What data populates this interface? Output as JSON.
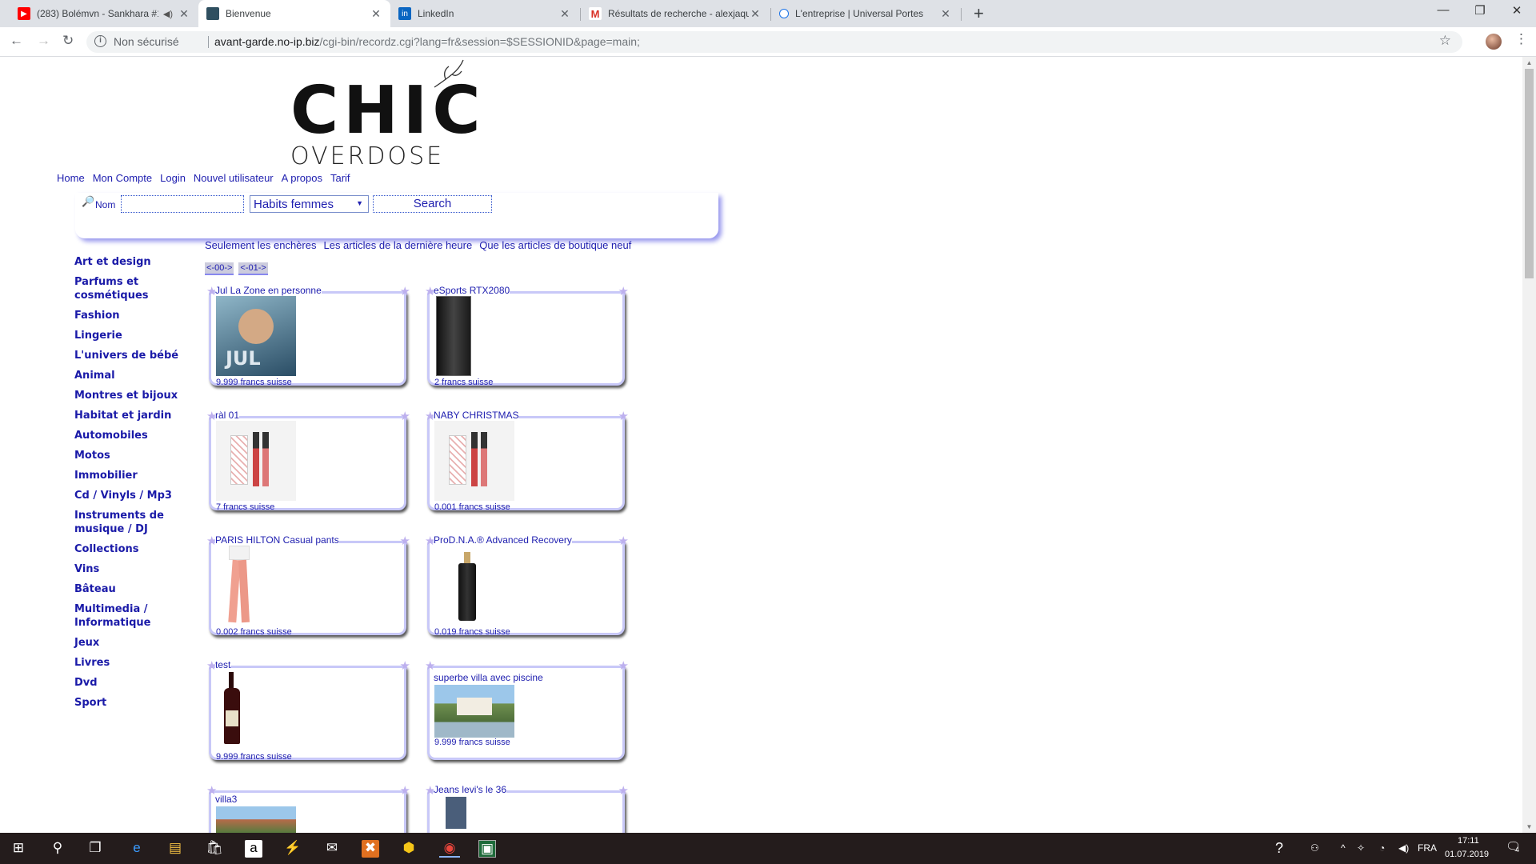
{
  "browser": {
    "tabs": [
      {
        "title": "(283) Bolémvn - Sankhara #1",
        "icon": "youtube-icon",
        "active": false
      },
      {
        "title": "Bienvenue",
        "icon": "site-favicon",
        "active": true
      },
      {
        "title": "LinkedIn",
        "icon": "linkedin-icon",
        "active": false
      },
      {
        "title": "Résultats de recherche - alexjaqu",
        "icon": "gmail-icon",
        "active": false
      },
      {
        "title": "L'entreprise | Universal Portes",
        "icon": "globe-icon",
        "active": false
      }
    ],
    "security_label": "Non sécurisé",
    "url_host": "avant-garde.no-ip.biz",
    "url_path": "/cgi-bin/recordz.cgi?lang=fr&session=$SESSIONID&page=main;"
  },
  "site": {
    "logo_top": "CHIC",
    "logo_bottom": "OVERDOSE",
    "nav": [
      "Home",
      "Mon Compte",
      "Login",
      "Nouvel utilisateur",
      "A propos",
      "Tarif"
    ],
    "search": {
      "label": "Nom",
      "value": "",
      "category": "Habits femmes",
      "button": "Search"
    },
    "filters": [
      "Seulement les enchères",
      "Les articles de la dernière heure",
      "Que les articles de boutique neuf"
    ],
    "pages": [
      "<-00->",
      "<-01->"
    ],
    "categories": [
      "Art et design",
      "Parfums et cosmétiques",
      "Fashion",
      "Lingerie",
      "L'univers de bébé",
      "Animal",
      "Montres et bijoux",
      "Habitat et jardin",
      "Automobiles",
      "Motos",
      "Immobilier",
      "Cd / Vinyls / Mp3",
      "Instruments de musique / DJ",
      "Collections",
      "Vins",
      "Bâteau",
      "Multimedia / Informatique",
      "Jeux",
      "Livres",
      "Dvd",
      "Sport"
    ],
    "products": [
      {
        "title": "Jul La Zone en personne",
        "price": "9.999 francs suisse",
        "image": "album-cover"
      },
      {
        "title": "eSports RTX2080",
        "price": "2 francs suisse",
        "image": "pc-tower"
      },
      {
        "title": "ràl 01",
        "price": "7 francs suisse",
        "image": "lipgloss-set"
      },
      {
        "title": "NABY CHRISTMAS",
        "price": "0.001 francs suisse",
        "image": "lipgloss-set"
      },
      {
        "title": "PARIS HILTON Casual pants",
        "price": "0.002 francs suisse",
        "image": "pink-pants"
      },
      {
        "title": "ProD.N.A.® Advanced Recovery",
        "price": "0.019 francs suisse",
        "image": "serum-bottle"
      },
      {
        "title": "test",
        "price": "9.999 francs suisse",
        "image": "wine-bottle"
      },
      {
        "title": "superbe villa avec piscine",
        "price": "9.999 francs suisse",
        "image": "villa"
      },
      {
        "title": "villa3",
        "price": "",
        "image": "villa"
      },
      {
        "title": "Jeans levi's le 36",
        "price": "",
        "image": "jeans"
      }
    ]
  },
  "taskbar": {
    "lang": "FRA",
    "time": "17:11",
    "date": "01.07.2019",
    "notifications": "4"
  }
}
